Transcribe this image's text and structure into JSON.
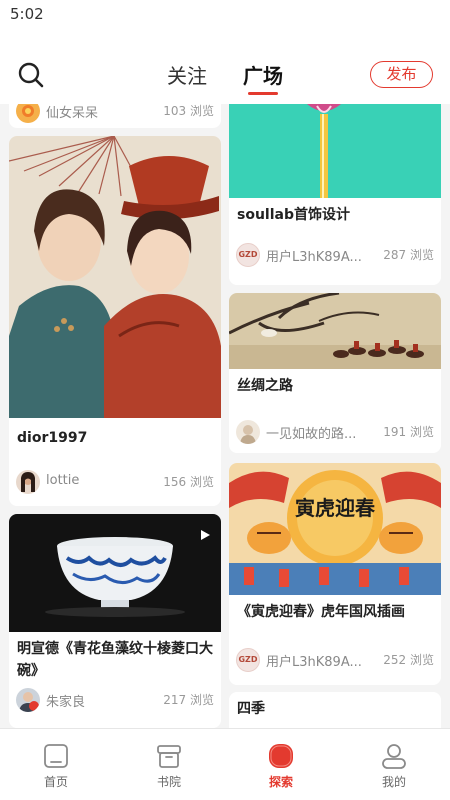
{
  "status": {
    "time": "5:02"
  },
  "header": {
    "tabs": [
      {
        "label": "关注"
      },
      {
        "label": "广场"
      }
    ],
    "active_tab": "广场",
    "publish_label": "发布"
  },
  "left_column": [
    {
      "title": "",
      "author": "仙女呆呆",
      "views": "103 浏览"
    },
    {
      "title": "dior1997",
      "author": "lottie",
      "views": "156 浏览"
    },
    {
      "title": "明宣德《青花鱼藻纹十棱菱口大碗》",
      "author": "朱家良",
      "views": "217 浏览"
    }
  ],
  "right_column": [
    {
      "title": "soullab首饰设计",
      "avatar_text": "GZD",
      "author": "用户L3hK89A...",
      "views": "287 浏览"
    },
    {
      "title": "丝绸之路",
      "author": "一见如故的路...",
      "views": "191 浏览"
    },
    {
      "title": "《寅虎迎春》虎年国风插画",
      "avatar_text": "GZD",
      "author": "用户L3hK89A...",
      "views": "252 浏览"
    },
    {
      "title": "四季"
    }
  ],
  "artwork_text": {
    "tiger_poster": "寅虎迎春"
  },
  "bottom_nav": [
    {
      "label": "首页"
    },
    {
      "label": "书院"
    },
    {
      "label": "探索"
    },
    {
      "label": "我的"
    }
  ],
  "active_nav": "探索",
  "colors": {
    "accent": "#e33a2f",
    "background": "#f4f4f4",
    "card": "#ffffff"
  }
}
